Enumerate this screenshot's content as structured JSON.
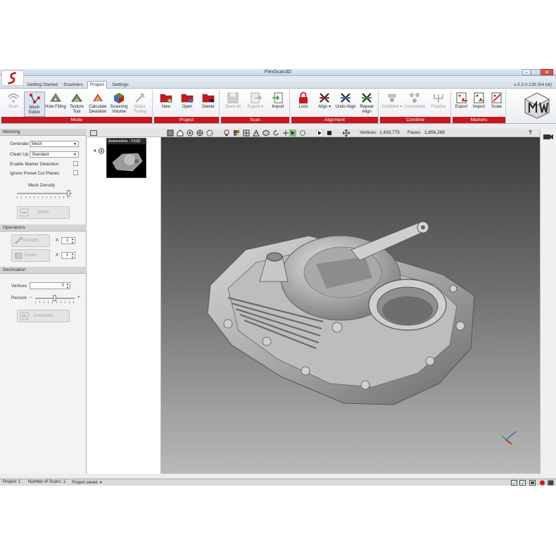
{
  "window": {
    "title": "FlexScan3D",
    "minimize": "–",
    "maximize": "□",
    "close": "✕"
  },
  "tabs": [
    {
      "label": "Getting Started",
      "active": false
    },
    {
      "label": "Scanners",
      "active": false
    },
    {
      "label": "Project",
      "active": true
    },
    {
      "label": "Settings",
      "active": false
    }
  ],
  "version": "v.3.3.0.138 (64 bit)",
  "ribbon": {
    "groups": [
      {
        "name": "Mode",
        "buttons": [
          {
            "label": "Scan",
            "icon": "wifi-scan-icon",
            "disabled": true
          },
          {
            "label": "Mesh Editor",
            "icon": "mesh-editor-icon",
            "disabled": false,
            "selected": true
          },
          {
            "label": "Hole Filling",
            "icon": "hole-filling-icon",
            "disabled": false
          },
          {
            "label": "Texture Tool",
            "icon": "texture-tool-icon",
            "disabled": false
          },
          {
            "label": "Calculate Deviation",
            "icon": "calculate-deviation-icon",
            "disabled": false
          },
          {
            "label": "Scanning Volume",
            "icon": "scanning-volume-icon",
            "disabled": false
          },
          {
            "label": "Baltur Tuning",
            "icon": "tuning-icon",
            "disabled": true
          }
        ]
      },
      {
        "name": "Project",
        "buttons": [
          {
            "label": "New",
            "icon": "folder-new-icon",
            "disabled": false
          },
          {
            "label": "Open",
            "icon": "folder-open-icon",
            "disabled": false
          },
          {
            "label": "Delete",
            "icon": "folder-delete-icon",
            "disabled": false
          }
        ]
      },
      {
        "name": "Scan",
        "buttons": [
          {
            "label": "Save All",
            "icon": "save-all-icon",
            "disabled": true
          },
          {
            "label": "Export ▾",
            "icon": "export-icon",
            "disabled": true
          },
          {
            "label": "Import",
            "icon": "import-icon",
            "disabled": false
          }
        ]
      },
      {
        "name": "Alignment",
        "buttons": [
          {
            "label": "Lock",
            "icon": "lock-icon",
            "disabled": false
          },
          {
            "label": "Align ▾",
            "icon": "align-icon",
            "disabled": false
          },
          {
            "label": "Undo Align",
            "icon": "undo-align-icon",
            "disabled": false
          },
          {
            "label": "Repeat Align",
            "icon": "repeat-align-icon",
            "disabled": false
          }
        ]
      },
      {
        "name": "Combine",
        "buttons": [
          {
            "label": "Combine ▾",
            "icon": "combine-icon",
            "disabled": true
          },
          {
            "label": "Uncombine",
            "icon": "uncombine-icon",
            "disabled": true
          },
          {
            "label": "Finalize",
            "icon": "finalize-icon",
            "disabled": true
          }
        ]
      },
      {
        "name": "Markers",
        "buttons": [
          {
            "label": "Export",
            "icon": "marker-export-icon",
            "disabled": false
          },
          {
            "label": "Import",
            "icon": "marker-import-icon",
            "disabled": false
          },
          {
            "label": "Scale",
            "icon": "marker-scale-icon",
            "disabled": false
          }
        ]
      }
    ]
  },
  "meshing": {
    "header": "Meshing",
    "generate_label": "Generate",
    "generate_value": "Mesh",
    "cleanup_label": "Clean Up",
    "cleanup_value": "Standard",
    "marker_detection_label": "Enable Marker Detection",
    "ignore_cut_planes_label": "Ignore Preset Cut Planes",
    "mesh_density_label": "Mesh Density",
    "mesh_density": 0.95,
    "weld_label": "Weld"
  },
  "operations": {
    "header": "Operations",
    "smooth_label": "Smooth",
    "smooth_x": "X",
    "smooth_value": "1",
    "erode_label": "Erode",
    "erode_x": "X",
    "erode_value": "1"
  },
  "decimation": {
    "header": "Decimation",
    "vertices_label": "Vertices",
    "vertices_value": "0",
    "percent_label": "Percent",
    "minus": "–",
    "plus": "+",
    "percent": 0.5,
    "decimate_label": "Decimate"
  },
  "scan_tree": {
    "thumbnail_caption": "Automotive - F53D"
  },
  "viewport_toolbar": {
    "vertices_label": "Vertices:",
    "vertices_value": "1,433,775",
    "faces_label": "Faces:",
    "faces_value": "2,856,268",
    "help": "?"
  },
  "statusbar": {
    "project": "Project: 1",
    "scans": "Number of Scans: 1",
    "message": "Project saved. ▾"
  },
  "colors": {
    "accent_red": "#c8181e",
    "viewport_top": "#3c3c3c",
    "viewport_bottom": "#b9b9b9"
  }
}
